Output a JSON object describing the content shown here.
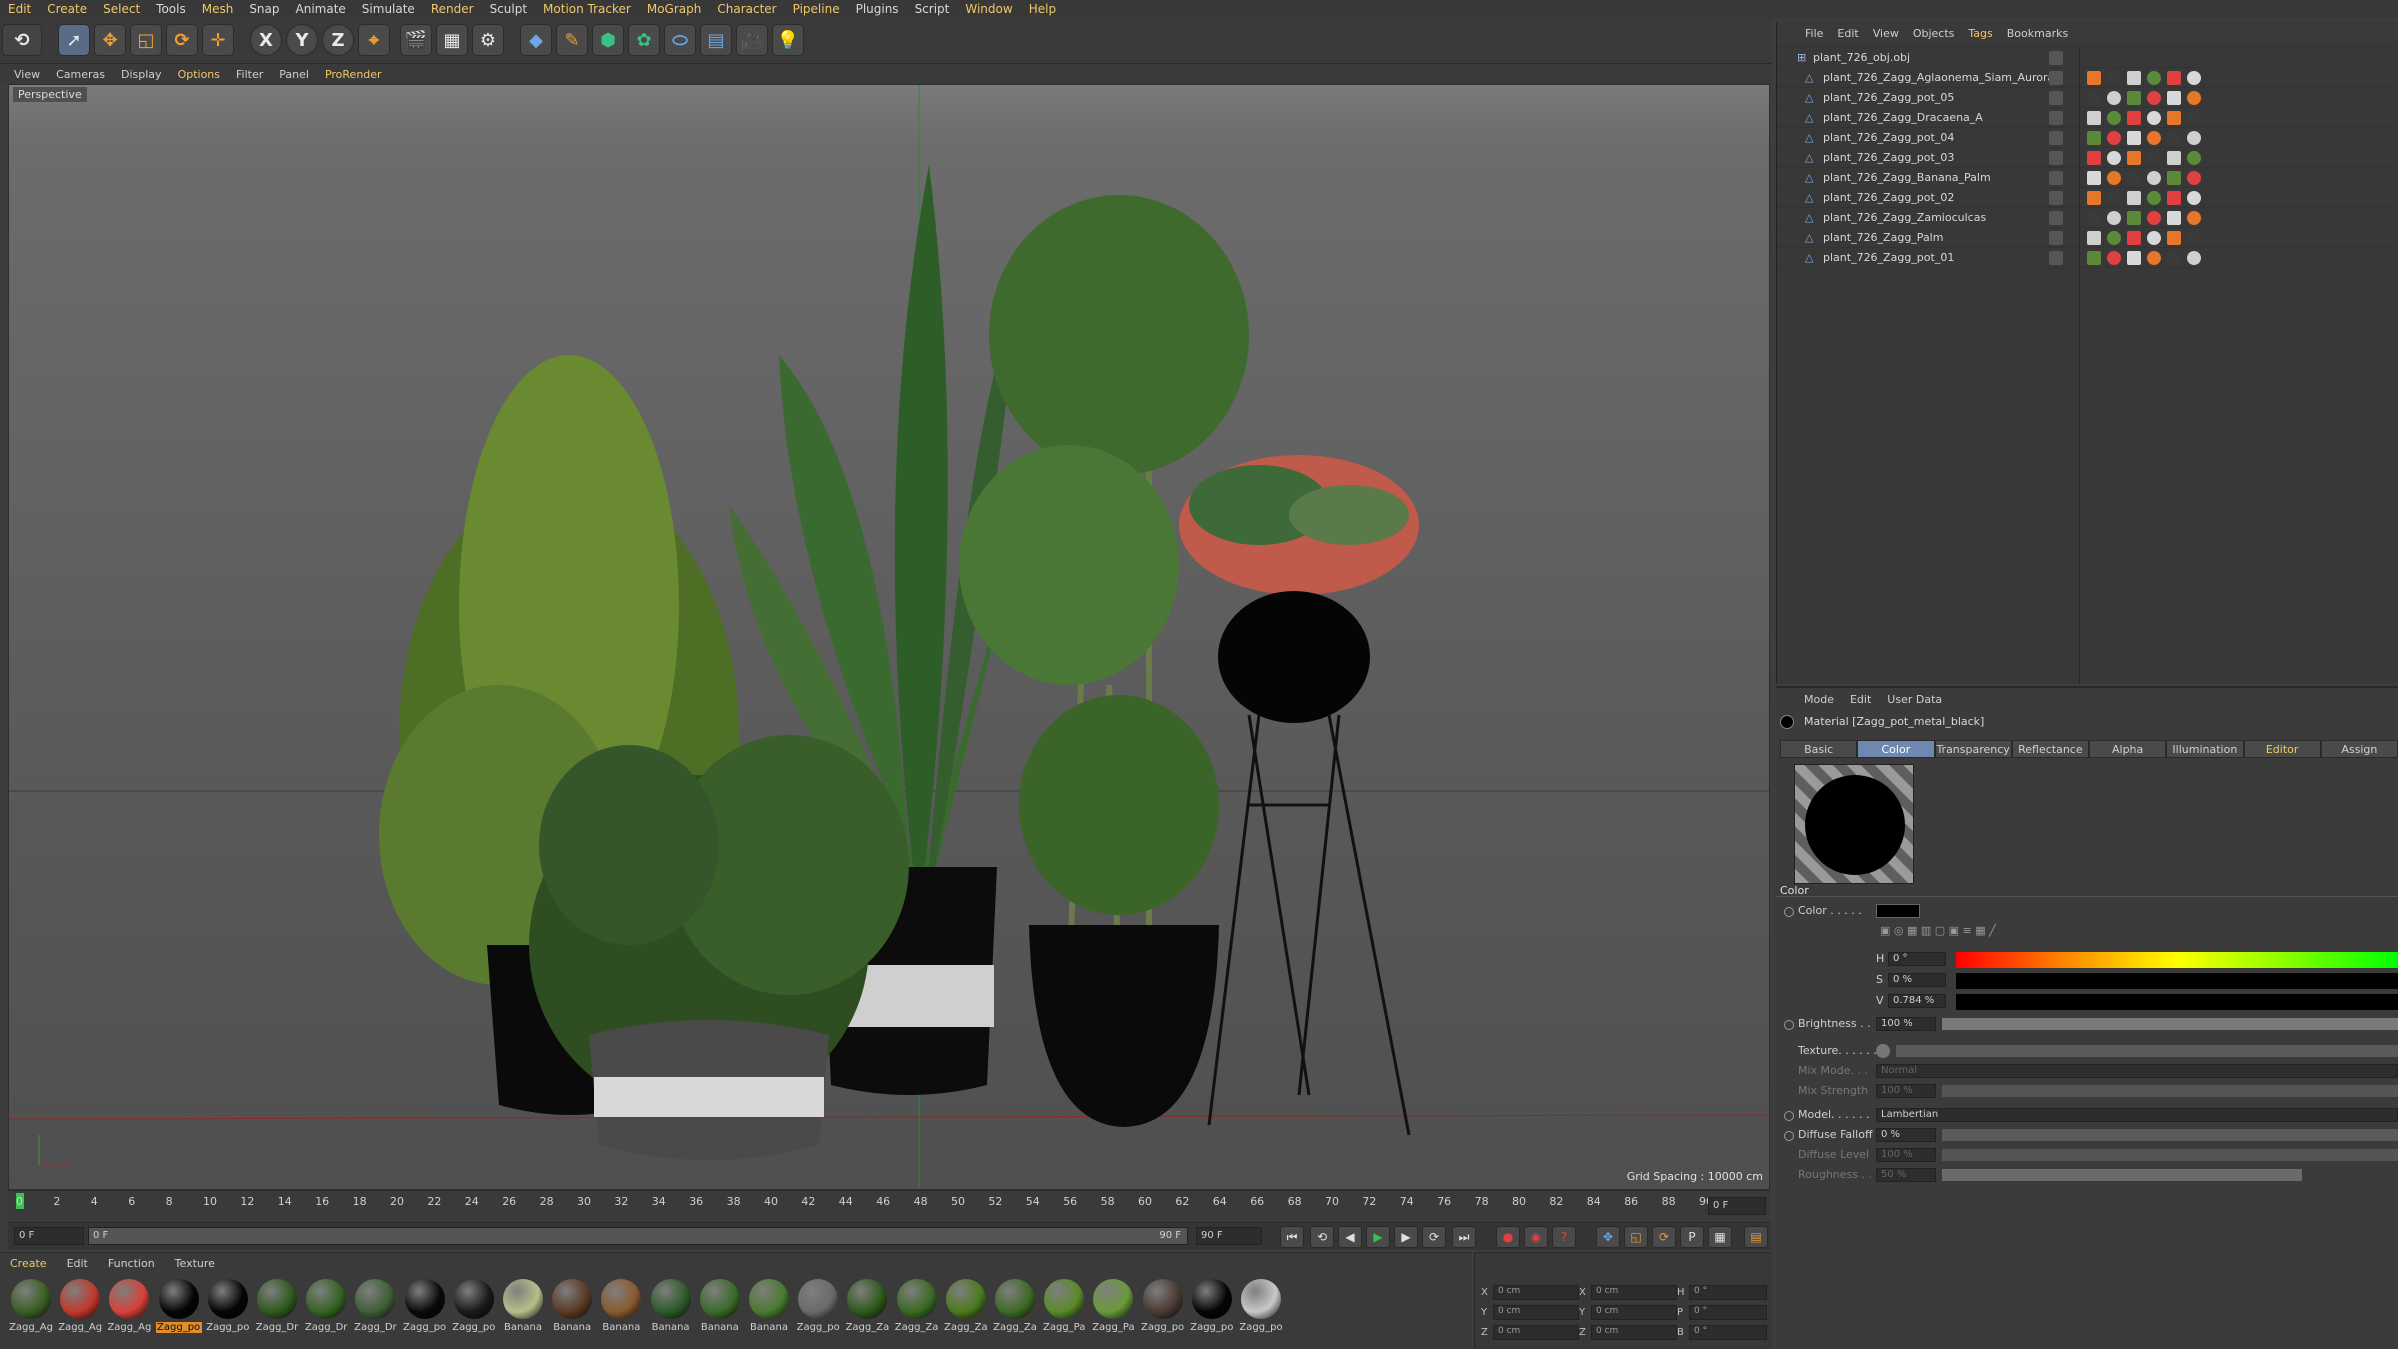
{
  "menu": [
    "Edit",
    "Create",
    "Select",
    "Tools",
    "Mesh",
    "Snap",
    "Animate",
    "Simulate",
    "Render",
    "Sculpt",
    "Motion Tracker",
    "MoGraph",
    "Character",
    "Pipeline",
    "Plugins",
    "Script",
    "Window",
    "Help"
  ],
  "toolbar": {
    "axis_x": "X",
    "axis_y": "Y",
    "axis_z": "Z"
  },
  "viewport_menu": [
    "View",
    "Cameras",
    "Display",
    "Options",
    "Filter",
    "Panel",
    "ProRender"
  ],
  "viewport": {
    "label": "Perspective",
    "grid_spacing": "Grid Spacing : 10000 cm"
  },
  "timeline": {
    "ticks": [
      "0",
      "2",
      "4",
      "6",
      "8",
      "10",
      "12",
      "14",
      "16",
      "18",
      "20",
      "22",
      "24",
      "26",
      "28",
      "30",
      "32",
      "34",
      "36",
      "38",
      "40",
      "42",
      "44",
      "46",
      "48",
      "50",
      "52",
      "54",
      "56",
      "58",
      "60",
      "62",
      "64",
      "66",
      "68",
      "70",
      "72",
      "74",
      "76",
      "78",
      "80",
      "82",
      "84",
      "86",
      "88",
      "90"
    ],
    "frame_end_label": "0 F"
  },
  "transport": {
    "current_frame": "0 F",
    "range_start": "0 F",
    "range_end": "90 F",
    "max_frame": "90 F"
  },
  "material_menu": [
    "Create",
    "Edit",
    "Function",
    "Texture"
  ],
  "materials": [
    {
      "label": "Zagg_Ag",
      "color": "#3b5e22"
    },
    {
      "label": "Zagg_Ag",
      "color": "#c0392b"
    },
    {
      "label": "Zagg_Ag",
      "color": "#d64238"
    },
    {
      "label": "Zagg_po",
      "color": "#050505"
    },
    {
      "label": "Zagg_po",
      "color": "#050505"
    },
    {
      "label": "Zagg_Dr",
      "color": "#2f5a1e"
    },
    {
      "label": "Zagg_Dr",
      "color": "#356224"
    },
    {
      "label": "Zagg_Dr",
      "color": "#3e5f35"
    },
    {
      "label": "Zagg_po",
      "color": "#0a0a0a"
    },
    {
      "label": "Zagg_po",
      "color": "#1a1a1a"
    },
    {
      "label": "Banana",
      "color": "#b6bf8a"
    },
    {
      "label": "Banana",
      "color": "#5a3a24"
    },
    {
      "label": "Banana",
      "color": "#8a5a2e"
    },
    {
      "label": "Banana",
      "color": "#2d5a2a"
    },
    {
      "label": "Banana",
      "color": "#3b6b2a"
    },
    {
      "label": "Banana",
      "color": "#4a7a2e"
    },
    {
      "label": "Zagg_po",
      "color": "#6a6a6a"
    },
    {
      "label": "Zagg_Za",
      "color": "#2e5a1a"
    },
    {
      "label": "Zagg_Za",
      "color": "#3a6a22"
    },
    {
      "label": "Zagg_Za",
      "color": "#4a7a1e"
    },
    {
      "label": "Zagg_Za",
      "color": "#3e6a26"
    },
    {
      "label": "Zagg_Pa",
      "color": "#5a8a2a"
    },
    {
      "label": "Zagg_Pa",
      "color": "#6a9a3a"
    },
    {
      "label": "Zagg_po",
      "color": "#4a3a32"
    },
    {
      "label": "Zagg_po",
      "color": "#050505"
    },
    {
      "label": "Zagg_po",
      "color": "#c8c8c8"
    }
  ],
  "coords": {
    "x_pos": "0 cm",
    "y_pos": "0 cm",
    "z_pos": "0 cm",
    "x_size": "0 cm",
    "y_size": "0 cm",
    "z_size": "0 cm",
    "h": "0 °",
    "p": "0 °",
    "b": "0 °",
    "lx": "X",
    "ly": "Y",
    "lz": "Z",
    "lh": "H",
    "lp": "P",
    "lb": "B"
  },
  "object_menu": [
    "File",
    "Edit",
    "View",
    "Objects",
    "Tags",
    "Bookmarks"
  ],
  "objects": {
    "root": "plant_726_obj.obj",
    "children": [
      "plant_726_Zagg_Aglaonema_Siam_Aurora",
      "plant_726_Zagg_pot_05",
      "plant_726_Zagg_Dracaena_A",
      "plant_726_Zagg_pot_04",
      "plant_726_Zagg_pot_03",
      "plant_726_Zagg_Banana_Palm",
      "plant_726_Zagg_pot_02",
      "plant_726_Zagg_Zamioculcas",
      "plant_726_Zagg_Palm",
      "plant_726_Zagg_pot_01"
    ]
  },
  "attr_menu": [
    "Mode",
    "Edit",
    "User Data"
  ],
  "attributes": {
    "material": "Material [Zagg_pot_metal_black]",
    "tabs": [
      "Basic",
      "Color",
      "Transparency",
      "Reflectance",
      "Alpha",
      "Illumination",
      "Editor",
      "Assign"
    ],
    "section": "Color",
    "color_label": "Color . . . . .",
    "h_label": "H",
    "h_value": "0 °",
    "s_label": "S",
    "s_value": "0 %",
    "v_label": "V",
    "v_value": "0.784 %",
    "brightness_label": "Brightness . .",
    "brightness_value": "100 %",
    "texture_label": "Texture. . . . . .",
    "mix_mode_label": "Mix Mode. . .",
    "mix_mode_value": "Normal",
    "mix_strength_label": "Mix Strength",
    "mix_strength_value": "100 %",
    "model_label": "Model. . . . . .",
    "model_value": "Lambertian",
    "diffuse_falloff_label": "Diffuse Falloff",
    "diffuse_falloff_value": "0 %",
    "diffuse_level_label": "Diffuse Level",
    "diffuse_level_value": "100 %",
    "roughness_label": "Roughness . .",
    "roughness_value": "50 %"
  }
}
